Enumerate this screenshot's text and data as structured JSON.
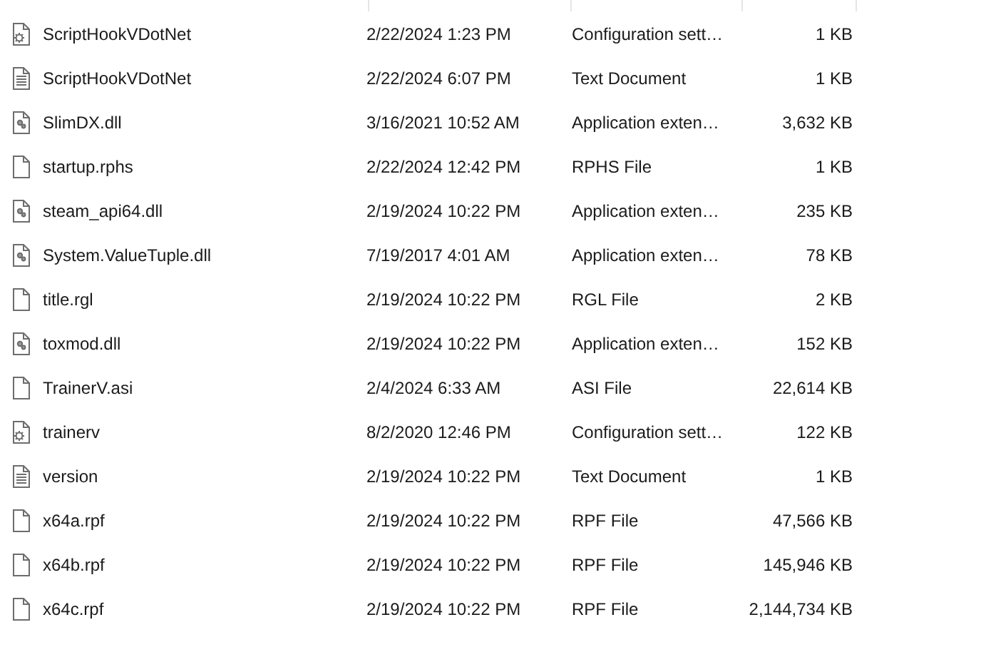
{
  "files": [
    {
      "name": "ScriptHookVDotNet",
      "kind": "config",
      "date_modified": "2/22/2024 1:23 PM",
      "type": "Configuration sett…",
      "size": "1 KB"
    },
    {
      "name": "ScriptHookVDotNet",
      "kind": "text",
      "date_modified": "2/22/2024 6:07 PM",
      "type": "Text Document",
      "size": "1 KB"
    },
    {
      "name": "SlimDX.dll",
      "kind": "extension",
      "date_modified": "3/16/2021 10:52 AM",
      "type": "Application exten…",
      "size": "3,632 KB"
    },
    {
      "name": "startup.rphs",
      "kind": "blank",
      "date_modified": "2/22/2024 12:42 PM",
      "type": "RPHS File",
      "size": "1 KB"
    },
    {
      "name": "steam_api64.dll",
      "kind": "extension",
      "date_modified": "2/19/2024 10:22 PM",
      "type": "Application exten…",
      "size": "235 KB"
    },
    {
      "name": "System.ValueTuple.dll",
      "kind": "extension",
      "date_modified": "7/19/2017 4:01 AM",
      "type": "Application exten…",
      "size": "78 KB"
    },
    {
      "name": "title.rgl",
      "kind": "blank",
      "date_modified": "2/19/2024 10:22 PM",
      "type": "RGL File",
      "size": "2 KB"
    },
    {
      "name": "toxmod.dll",
      "kind": "extension",
      "date_modified": "2/19/2024 10:22 PM",
      "type": "Application exten…",
      "size": "152 KB"
    },
    {
      "name": "TrainerV.asi",
      "kind": "blank",
      "date_modified": "2/4/2024 6:33 AM",
      "type": "ASI File",
      "size": "22,614 KB"
    },
    {
      "name": "trainerv",
      "kind": "config",
      "date_modified": "8/2/2020 12:46 PM",
      "type": "Configuration sett…",
      "size": "122 KB"
    },
    {
      "name": "version",
      "kind": "text",
      "date_modified": "2/19/2024 10:22 PM",
      "type": "Text Document",
      "size": "1 KB"
    },
    {
      "name": "x64a.rpf",
      "kind": "blank",
      "date_modified": "2/19/2024 10:22 PM",
      "type": "RPF File",
      "size": "47,566 KB"
    },
    {
      "name": "x64b.rpf",
      "kind": "blank",
      "date_modified": "2/19/2024 10:22 PM",
      "type": "RPF File",
      "size": "145,946 KB"
    },
    {
      "name": "x64c.rpf",
      "kind": "blank",
      "date_modified": "2/19/2024 10:22 PM",
      "type": "RPF File",
      "size": "2,144,734 KB"
    }
  ]
}
